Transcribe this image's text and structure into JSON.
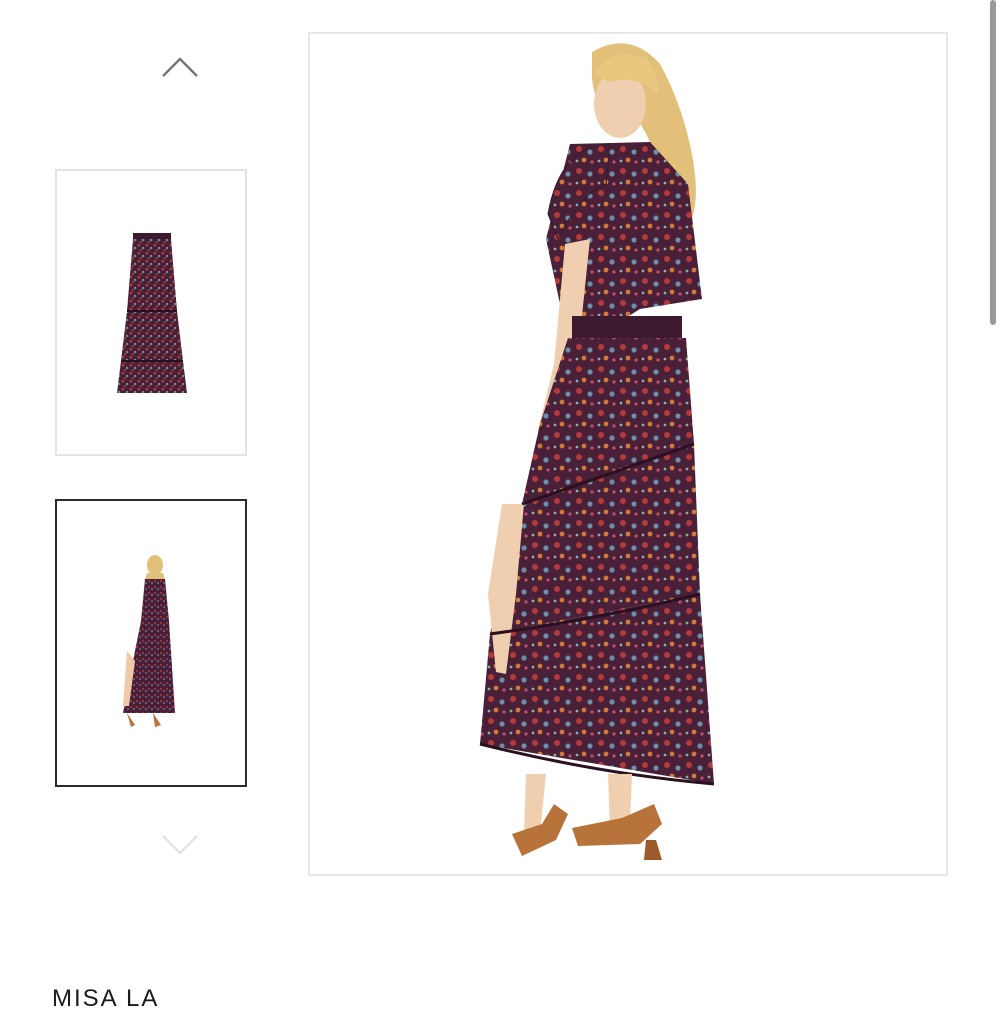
{
  "gallery": {
    "prev_icon": "chevron-up-icon",
    "next_icon": "chevron-down-icon",
    "thumbnails": [
      {
        "name": "skirt-front-thumbnail",
        "selected": false
      },
      {
        "name": "model-back-view-thumbnail",
        "selected": true
      }
    ],
    "main_image": "model-back-view-dress"
  },
  "product": {
    "brand": "MISA LA"
  },
  "colors": {
    "fabric": "#5a2840",
    "accent_red": "#b23a3a",
    "hair": "#e2c07a",
    "heels": "#b8733a",
    "selected_border": "#2b2b2b"
  }
}
